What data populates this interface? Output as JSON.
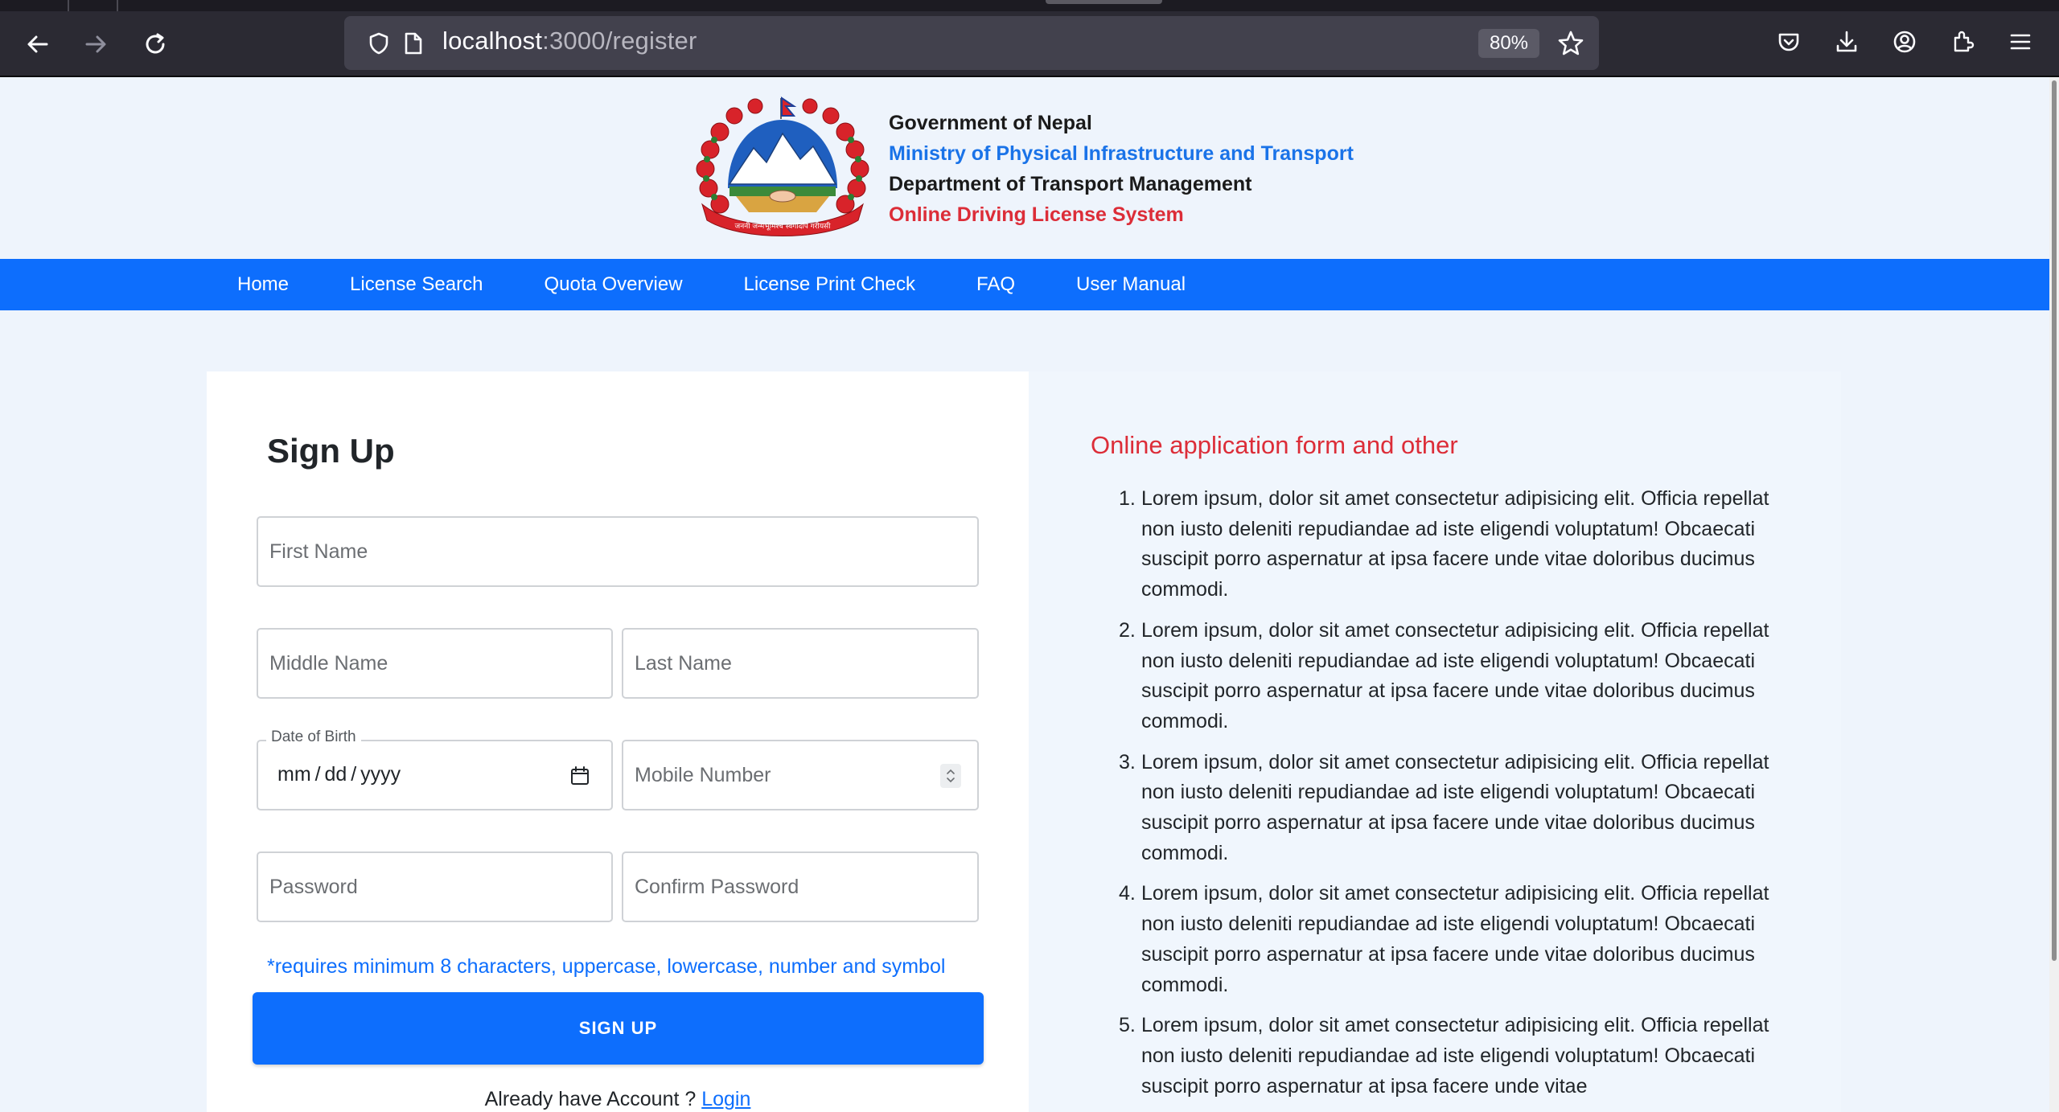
{
  "browser": {
    "url_host": "localhost",
    "url_path": ":3000/register",
    "zoom": "80%"
  },
  "header": {
    "line1": "Government of Nepal",
    "line2": "Ministry of Physical Infrastructure and Transport",
    "line3": "Department of Transport Management",
    "line4": "Online Driving License System",
    "emblem_motto": "जननी जन्मभूमिश्च स्वर्गादपि गरीयसी"
  },
  "nav": {
    "items": [
      "Home",
      "License Search",
      "Quota Overview",
      "License Print Check",
      "FAQ",
      "User Manual"
    ]
  },
  "signup": {
    "title": "Sign Up",
    "first_name_placeholder": "First Name",
    "middle_name_placeholder": "Middle Name",
    "last_name_placeholder": "Last Name",
    "dob_label": "Date of Birth",
    "dob_value": "mm / dd / yyyy",
    "mobile_placeholder": "Mobile Number",
    "password_placeholder": "Password",
    "confirm_password_placeholder": "Confirm Password",
    "password_hint": "*requires minimum 8 characters, uppercase, lowercase, number and symbol",
    "button_label": "SIGN UP",
    "login_prompt": "Already have Account ?",
    "login_link": "Login"
  },
  "info": {
    "title": "Online application form and other",
    "items": [
      {
        "num": "1.",
        "text": "Lorem ipsum, dolor sit amet consectetur adipisicing elit. Officia repellat non iusto deleniti repudiandae ad iste eligendi voluptatum! Obcaecati suscipit porro aspernatur at ipsa facere unde vitae doloribus ducimus commodi."
      },
      {
        "num": "2.",
        "text": "Lorem ipsum, dolor sit amet consectetur adipisicing elit. Officia repellat non iusto deleniti repudiandae ad iste eligendi voluptatum! Obcaecati suscipit porro aspernatur at ipsa facere unde vitae doloribus ducimus commodi."
      },
      {
        "num": "3.",
        "text": "Lorem ipsum, dolor sit amet consectetur adipisicing elit. Officia repellat non iusto deleniti repudiandae ad iste eligendi voluptatum! Obcaecati suscipit porro aspernatur at ipsa facere unde vitae doloribus ducimus commodi."
      },
      {
        "num": "4.",
        "text": "Lorem ipsum, dolor sit amet consectetur adipisicing elit. Officia repellat non iusto deleniti repudiandae ad iste eligendi voluptatum! Obcaecati suscipit porro aspernatur at ipsa facere unde vitae doloribus ducimus commodi."
      },
      {
        "num": "5.",
        "text": "Lorem ipsum, dolor sit amet consectetur adipisicing elit. Officia repellat non iusto deleniti repudiandae ad iste eligendi voluptatum! Obcaecati suscipit porro aspernatur at ipsa facere unde vitae"
      }
    ]
  },
  "colors": {
    "primary": "#0d6efd",
    "accent_red": "#dc2d38",
    "ministry_blue": "#1a73e8"
  }
}
